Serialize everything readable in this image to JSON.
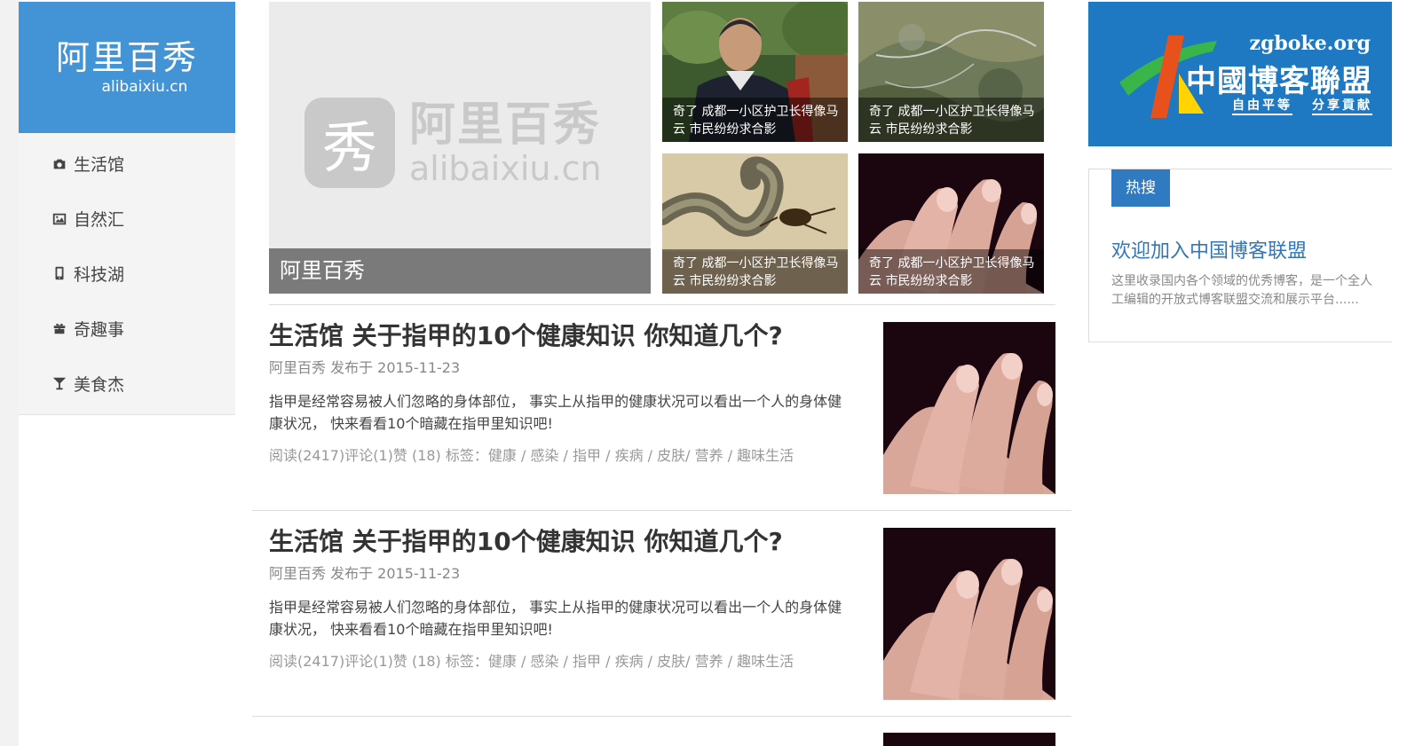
{
  "logo": {
    "cn": "阿里百秀",
    "en": "alibaixiu.cn"
  },
  "nav": [
    {
      "label": "生活馆",
      "icon": "camera-icon"
    },
    {
      "label": "自然汇",
      "icon": "image-icon"
    },
    {
      "label": "科技湖",
      "icon": "phone-icon"
    },
    {
      "label": "奇趣事",
      "icon": "gift-icon"
    },
    {
      "label": "美食杰",
      "icon": "cocktail-icon"
    }
  ],
  "hero": {
    "caption": "阿里百秀",
    "watermark_glyph": "秀",
    "watermark_cn": "阿里百秀",
    "watermark_en": "alibaixiu.cn"
  },
  "thumbs": [
    {
      "caption": "奇了 成都一小区护卫长得像马云 市民纷纷求合影",
      "image": "man-photo"
    },
    {
      "caption": "奇了 成都一小区护卫长得像马云 市民纷纷求合影",
      "image": "map-photo"
    },
    {
      "caption": "奇了 成都一小区护卫长得像马云 市民纷纷求合影",
      "image": "snake-photo"
    },
    {
      "caption": "奇了 成都一小区护卫长得像马云 市民纷纷求合影",
      "image": "nails-photo"
    }
  ],
  "articles": [
    {
      "title": "生活馆 关于指甲的10个健康知识 你知道几个?",
      "meta": "阿里百秀 发布于 2015-11-23",
      "excerpt": "指甲是经常容易被人们忽略的身体部位， 事实上从指甲的健康状况可以看出一个人的身体健康状况， 快来看看10个暗藏在指甲里知识吧!",
      "stats": "阅读(2417)评论(1)赞 (18) 标签：健康 / 感染 / 指甲 / 疾病 / 皮肤/ 营养 / 趣味生活"
    },
    {
      "title": "生活馆 关于指甲的10个健康知识 你知道几个?",
      "meta": "阿里百秀 发布于 2015-11-23",
      "excerpt": "指甲是经常容易被人们忽略的身体部位， 事实上从指甲的健康状况可以看出一个人的身体健康状况， 快来看看10个暗藏在指甲里知识吧!",
      "stats": "阅读(2417)评论(1)赞 (18) 标签：健康 / 感染 / 指甲 / 疾病 / 皮肤/ 营养 / 趣味生活"
    }
  ],
  "banner": {
    "url": "zgboke.org",
    "name": "中國博客聯盟",
    "motto_left": "自由平等",
    "motto_right": "分享貢献"
  },
  "hot": {
    "tab": "热搜",
    "title": "欢迎加入中国博客联盟",
    "desc": "这里收录国内各个领域的优秀博客，是一个全人工编辑的开放式博客联盟交流和展示平台......"
  },
  "colors": {
    "brand_blue": "#4394d6",
    "banner_blue": "#1e78c2",
    "link_blue": "#3277b5"
  }
}
